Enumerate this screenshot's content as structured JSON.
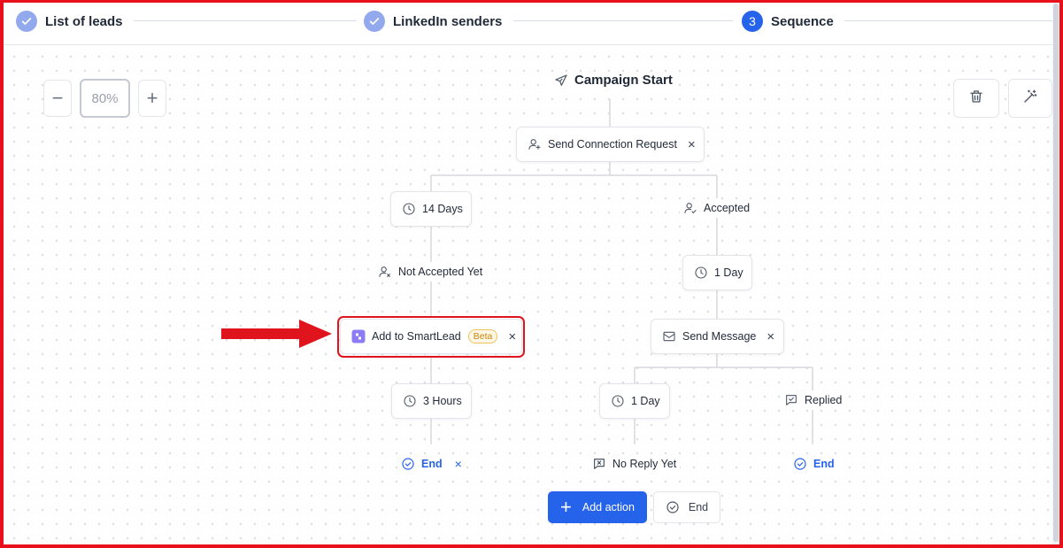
{
  "stepper": {
    "steps": [
      {
        "label": "List of leads",
        "state": "done"
      },
      {
        "label": "LinkedIn senders",
        "state": "done"
      },
      {
        "label": "Sequence",
        "number": "3",
        "state": "active"
      }
    ]
  },
  "zoom": {
    "value": "80%",
    "minus": "−",
    "plus": "+"
  },
  "flow": {
    "start": "Campaign Start",
    "send_connection": "Send Connection Request",
    "wait_14_days": "14 Days",
    "accepted": "Accepted",
    "not_accepted": "Not Accepted Yet",
    "wait_1_day_a": "1 Day",
    "add_smartlead": "Add to SmartLead",
    "beta": "Beta",
    "send_message": "Send Message",
    "wait_3_hours": "3 Hours",
    "wait_1_day_b": "1 Day",
    "replied": "Replied",
    "end_left": "End",
    "no_reply": "No Reply Yet",
    "end_right": "End"
  },
  "actions": {
    "add_action": "Add action",
    "end": "End"
  },
  "colors": {
    "accent": "#2563eb",
    "highlight": "#e0141c",
    "step_done": "#93a9ee"
  },
  "icons": [
    "check-icon",
    "paper-plane-icon",
    "user-plus-icon",
    "clock-icon",
    "user-check-icon",
    "user-x-icon",
    "smartlead-icon",
    "mail-icon",
    "message-check-icon",
    "message-x-icon",
    "check-circle-icon",
    "trash-icon",
    "magic-wand-icon",
    "close-icon",
    "plus-icon",
    "minus-icon",
    "red-arrow-annotation"
  ]
}
